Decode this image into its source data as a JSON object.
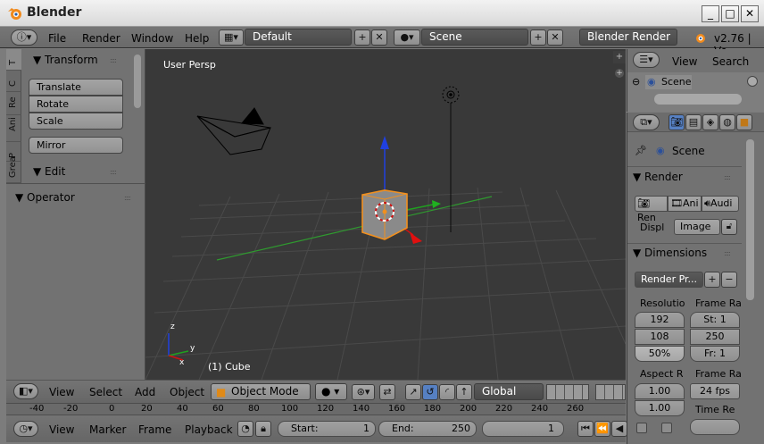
{
  "window": {
    "title": "Blender",
    "min": "_",
    "max": "□",
    "close": "✕"
  },
  "topbar": {
    "menus": [
      "File",
      "Render",
      "Window",
      "Help"
    ],
    "layout": "Default",
    "scene": "Scene",
    "engine": "Blender Render",
    "version": "v2.76 | Ve"
  },
  "toolshelf": {
    "tabs": [
      "T",
      "C",
      "Re",
      "Ani",
      "P",
      "Grea"
    ],
    "transform_header": "Transform",
    "buttons": [
      "Translate",
      "Rotate",
      "Scale",
      "Mirror"
    ],
    "edit_header": "Edit",
    "operator_header": "Operator"
  },
  "viewport": {
    "view_label": "User Persp",
    "object_label": "(1) Cube",
    "axis_z": "z",
    "axis_y": "y",
    "axis_x": "x"
  },
  "view3d_header": {
    "menus": [
      "View",
      "Select",
      "Add",
      "Object"
    ],
    "mode": "Object Mode",
    "orientation": "Global"
  },
  "ruler": {
    "ticks": [
      "-40",
      "-20",
      "0",
      "20",
      "40",
      "60",
      "80",
      "100",
      "120",
      "140",
      "160",
      "180",
      "200",
      "220",
      "240",
      "260"
    ]
  },
  "timeline": {
    "menus": [
      "View",
      "Marker",
      "Frame",
      "Playback"
    ],
    "start_label": "Start:",
    "start": "1",
    "end_label": "End:",
    "end": "250",
    "current": "1"
  },
  "outliner": {
    "menus": [
      "View",
      "Search"
    ],
    "item": "Scene"
  },
  "properties": {
    "scene": "Scene",
    "render_header": "Render",
    "render_buttons": [
      "Ren",
      "Ani",
      "Audi"
    ],
    "display_label": "Displ",
    "display_value": "Image",
    "dimensions_header": "Dimensions",
    "preset": "Render Pr...",
    "resolution_label": "Resolutio",
    "res_x": "192",
    "res_y": "108",
    "res_pct": "50%",
    "frame_range_label": "Frame Ra",
    "frame_start": "St: 1",
    "frame_end": "250",
    "frame_step": "Fr: 1",
    "aspect_label": "Aspect R",
    "aspect_x": "1.00",
    "aspect_y": "1.00",
    "frame_rate_label": "Frame Ra",
    "fps": "24 fps",
    "time_remap_label": "Time Re"
  },
  "colors": {
    "accent_orange": "#f09020",
    "axis_x": "#d01010",
    "axis_y": "#20a020",
    "axis_z": "#2040e0"
  }
}
